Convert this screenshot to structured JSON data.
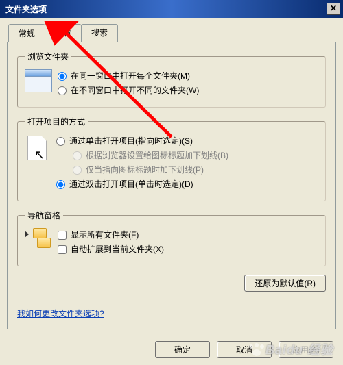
{
  "window": {
    "title": "文件夹选项",
    "close_glyph": "✕"
  },
  "tabs": {
    "general": "常规",
    "view": "查看",
    "search": "搜索"
  },
  "browse": {
    "legend": "浏览文件夹",
    "same_window": "在同一窗口中打开每个文件夹(M)",
    "new_window": "在不同窗口中打开不同的文件夹(W)"
  },
  "click": {
    "legend": "打开项目的方式",
    "single": "通过单击打开项目(指向时选定)(S)",
    "single_sub1": "根据浏览器设置给图标标题加下划线(B)",
    "single_sub2": "仅当指向图标标题时加下划线(P)",
    "double": "通过双击打开项目(单击时选定)(D)"
  },
  "nav": {
    "legend": "导航窗格",
    "show_all": "显示所有文件夹(F)",
    "auto_expand": "自动扩展到当前文件夹(X)"
  },
  "buttons": {
    "restore": "还原为默认值(R)",
    "ok": "确定",
    "cancel": "取消",
    "apply": "应用(A)"
  },
  "link": {
    "help": "我如何更改文件夹选项?"
  },
  "watermark": "Baidu 经验"
}
